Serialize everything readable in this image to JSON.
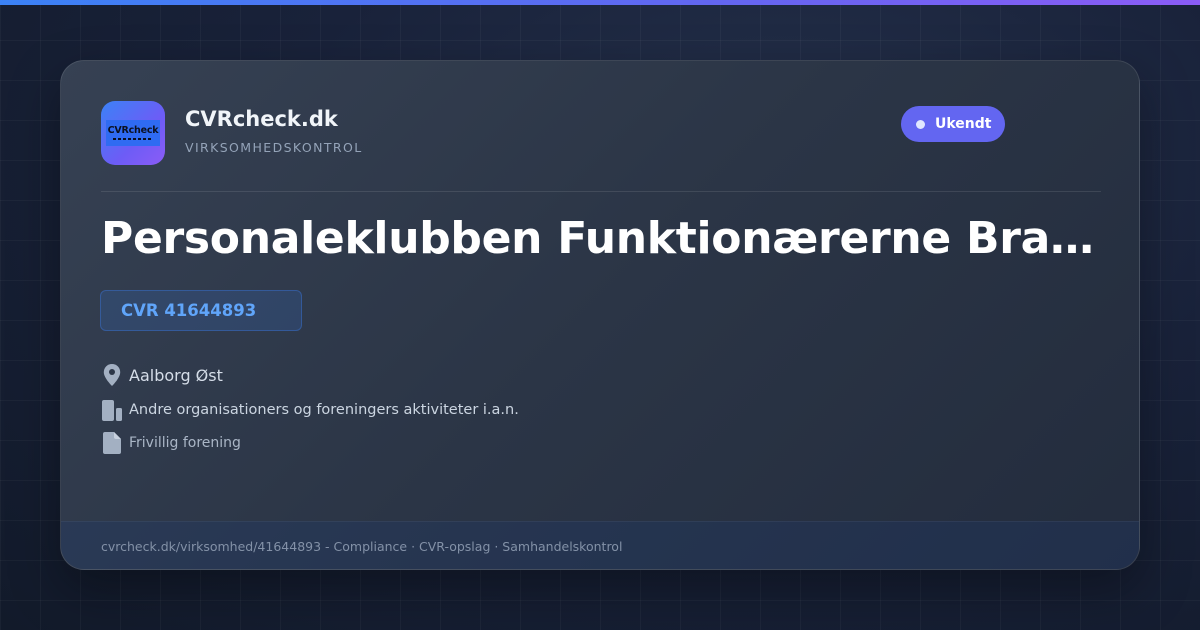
{
  "brand": {
    "logo_text": "CVRcheck",
    "name": "CVRcheck.dk",
    "tagline": "VIRKSOMHEDSKONTROL"
  },
  "status": {
    "label": "Ukendt",
    "color": "#6366f1"
  },
  "company": {
    "name": "Personaleklubben Funktionærerne Bravida",
    "cvr_label": "CVR 41644893",
    "location": "Aalborg Øst",
    "industry": "Andre organisationers og foreningers aktiviteter i.a.n.",
    "legal_form": "Frivillig forening"
  },
  "icons": {
    "location": "map-pin-icon",
    "industry": "building-icon",
    "legal_form": "document-icon"
  },
  "footer": {
    "text": "cvrcheck.dk/virksomhed/41644893 - Compliance · CVR-opslag · Samhandelskontrol"
  },
  "colors": {
    "accent": "#6366f1",
    "cvr": "#60a5fa",
    "background": "#141c2c"
  }
}
